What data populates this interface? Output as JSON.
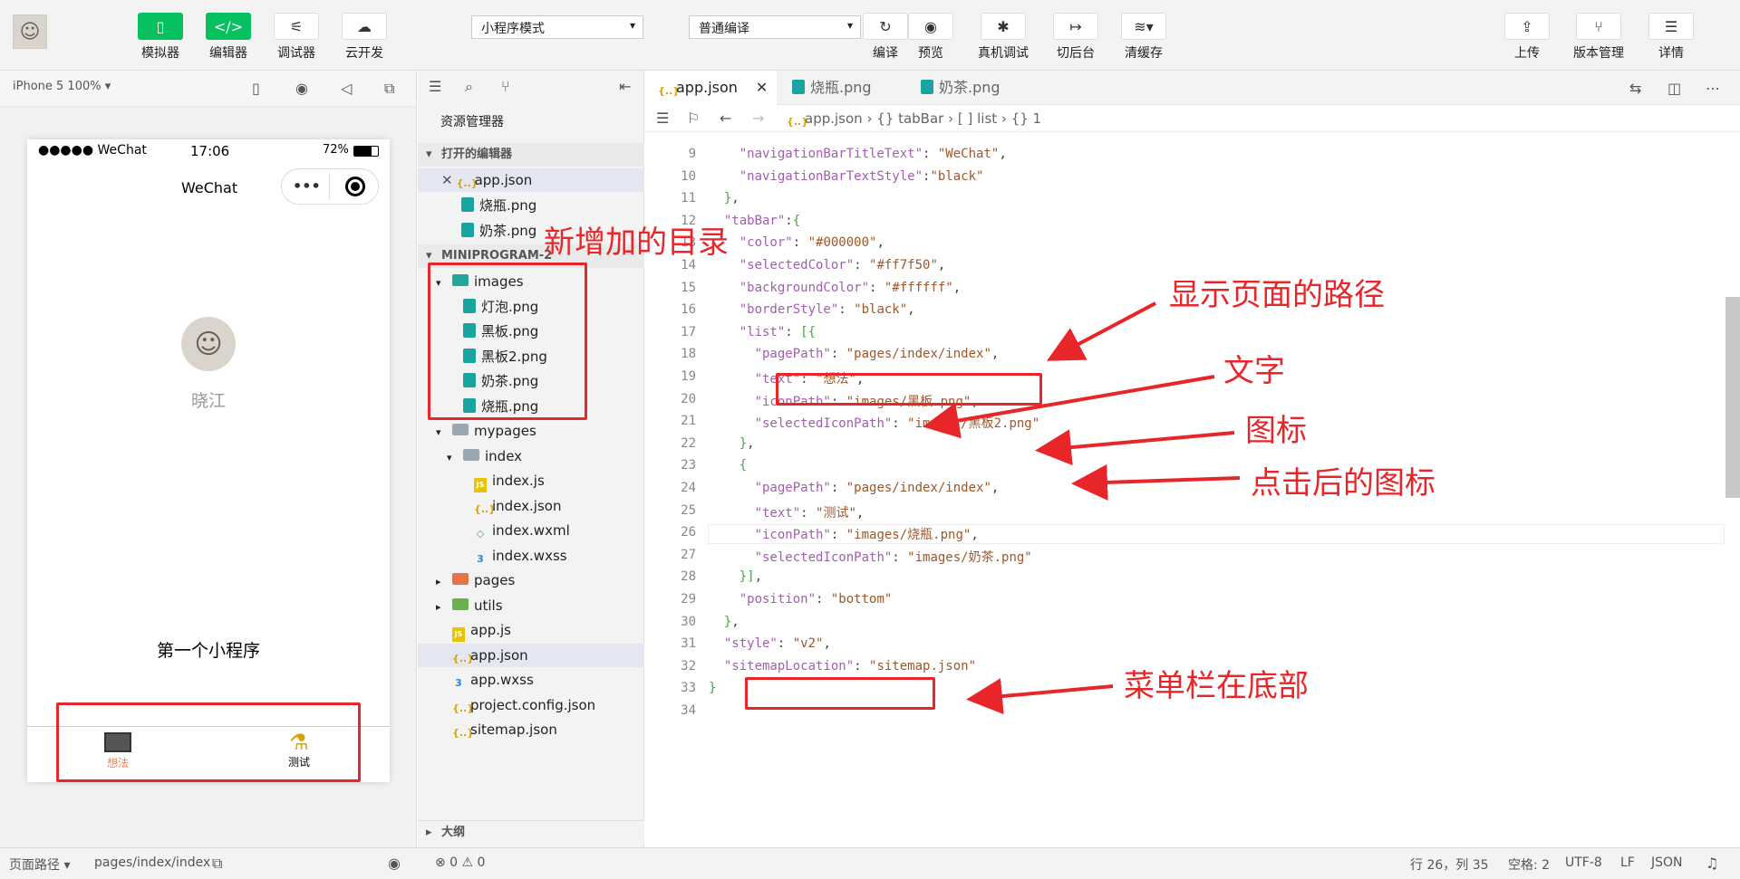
{
  "toolbar": {
    "simulator": "模拟器",
    "editor": "编辑器",
    "debugger": "调试器",
    "cloud": "云开发",
    "mode": "小程序模式",
    "compile_mode": "普通编译",
    "compile": "编译",
    "preview": "预览",
    "remote_debug": "真机调试",
    "background": "切后台",
    "clear_cache": "清缓存",
    "upload": "上传",
    "version": "版本管理",
    "details": "详情"
  },
  "simulator": {
    "device": "iPhone 5 100% ▾",
    "carrier": "●●●●● WeChat",
    "time": "17:06",
    "battery": "72%",
    "nav_title": "WeChat",
    "username": "晓江",
    "page_text": "第一个小程序",
    "tabbar": [
      {
        "text": "想法",
        "color": "#ff7f50"
      },
      {
        "text": "测试",
        "color": "#000000"
      }
    ]
  },
  "explorer": {
    "title": "资源管理器",
    "open_editors": "打开的编辑器",
    "open_files": [
      "app.json",
      "烧瓶.png",
      "奶茶.png"
    ],
    "project": "MINIPROGRAM-2",
    "tree": [
      {
        "name": "images",
        "indent": 1,
        "type": "folder images",
        "arrow": "▾"
      },
      {
        "name": "灯泡.png",
        "indent": 2,
        "type": "png",
        "arrow": ""
      },
      {
        "name": "黑板.png",
        "indent": 2,
        "type": "png",
        "arrow": ""
      },
      {
        "name": "黑板2.png",
        "indent": 2,
        "type": "png",
        "arrow": ""
      },
      {
        "name": "奶茶.png",
        "indent": 2,
        "type": "png",
        "arrow": ""
      },
      {
        "name": "烧瓶.png",
        "indent": 2,
        "type": "png",
        "arrow": ""
      },
      {
        "name": "mypages",
        "indent": 1,
        "type": "folder",
        "arrow": "▾"
      },
      {
        "name": "index",
        "indent": 2,
        "type": "folder",
        "arrow": "▾"
      },
      {
        "name": "index.js",
        "indent": 3,
        "type": "js",
        "arrow": ""
      },
      {
        "name": "index.json",
        "indent": 3,
        "type": "json",
        "arrow": ""
      },
      {
        "name": "index.wxml",
        "indent": 3,
        "type": "wxml",
        "arrow": ""
      },
      {
        "name": "index.wxss",
        "indent": 3,
        "type": "wxss",
        "arrow": ""
      },
      {
        "name": "pages",
        "indent": 1,
        "type": "folder pages",
        "arrow": "▸"
      },
      {
        "name": "utils",
        "indent": 1,
        "type": "folder utils",
        "arrow": "▸"
      },
      {
        "name": "app.js",
        "indent": 1,
        "type": "js",
        "arrow": ""
      },
      {
        "name": "app.json",
        "indent": 1,
        "type": "json",
        "arrow": ""
      },
      {
        "name": "app.wxss",
        "indent": 1,
        "type": "wxss",
        "arrow": ""
      },
      {
        "name": "project.config.json",
        "indent": 1,
        "type": "json",
        "arrow": ""
      },
      {
        "name": "sitemap.json",
        "indent": 1,
        "type": "json",
        "arrow": ""
      }
    ],
    "outline": "大纲"
  },
  "editor": {
    "tabs": [
      "app.json",
      "烧瓶.png",
      "奶茶.png"
    ],
    "breadcrumb": [
      "app.json",
      "{} tabBar",
      "[ ] list",
      "{} 1"
    ],
    "lines": [
      {
        "n": "9",
        "t": "    \"navigationBarTitleText\": \"WeChat\","
      },
      {
        "n": "10",
        "t": "    \"navigationBarTextStyle\":\"black\""
      },
      {
        "n": "11",
        "t": "  },"
      },
      {
        "n": "12",
        "t": "  \"tabBar\":{"
      },
      {
        "n": "13",
        "t": "    \"color\": \"#000000\","
      },
      {
        "n": "14",
        "t": "    \"selectedColor\": \"#ff7f50\","
      },
      {
        "n": "15",
        "t": "    \"backgroundColor\": \"#ffffff\","
      },
      {
        "n": "16",
        "t": "    \"borderStyle\": \"black\","
      },
      {
        "n": "17",
        "t": "    \"list\": [{"
      },
      {
        "n": "18",
        "t": "      \"pagePath\": \"pages/index/index\","
      },
      {
        "n": "19",
        "t": "      \"text\": \"想法\","
      },
      {
        "n": "20",
        "t": "      \"iconPath\": \"images/黑板.png\","
      },
      {
        "n": "21",
        "t": "      \"selectedIconPath\": \"images/黑板2.png\""
      },
      {
        "n": "22",
        "t": "    },"
      },
      {
        "n": "23",
        "t": "    {"
      },
      {
        "n": "24",
        "t": "      \"pagePath\": \"pages/index/index\","
      },
      {
        "n": "25",
        "t": "      \"text\": \"测试\","
      },
      {
        "n": "26",
        "t": "      \"iconPath\": \"images/烧瓶.png\","
      },
      {
        "n": "27",
        "t": "      \"selectedIconPath\": \"images/奶茶.png\""
      },
      {
        "n": "28",
        "t": "    }],"
      },
      {
        "n": "29",
        "t": "    \"position\": \"bottom\""
      },
      {
        "n": "30",
        "t": "  },"
      },
      {
        "n": "31",
        "t": "  \"style\": \"v2\","
      },
      {
        "n": "32",
        "t": "  \"sitemapLocation\": \"sitemap.json\""
      },
      {
        "n": "33",
        "t": "}"
      },
      {
        "n": "34",
        "t": ""
      }
    ]
  },
  "annotations": {
    "new_dir": "新增加的目录",
    "page_path": "显示页面的路径",
    "text": "文字",
    "icon": "图标",
    "selected_icon": "点击后的图标",
    "bottom": "菜单栏在底部"
  },
  "status": {
    "page_path_label": "页面路径 ▾",
    "page_path": "pages/index/index",
    "problems": "⊗ 0 ⚠ 0",
    "cursor": "行 26，列 35",
    "spaces": "空格: 2",
    "encoding": "UTF-8",
    "eol": "LF",
    "lang": "JSON"
  },
  "colors": {
    "accent": "#07c160",
    "annotation": "#e8262a",
    "selected_tab": "#ff7f50"
  }
}
